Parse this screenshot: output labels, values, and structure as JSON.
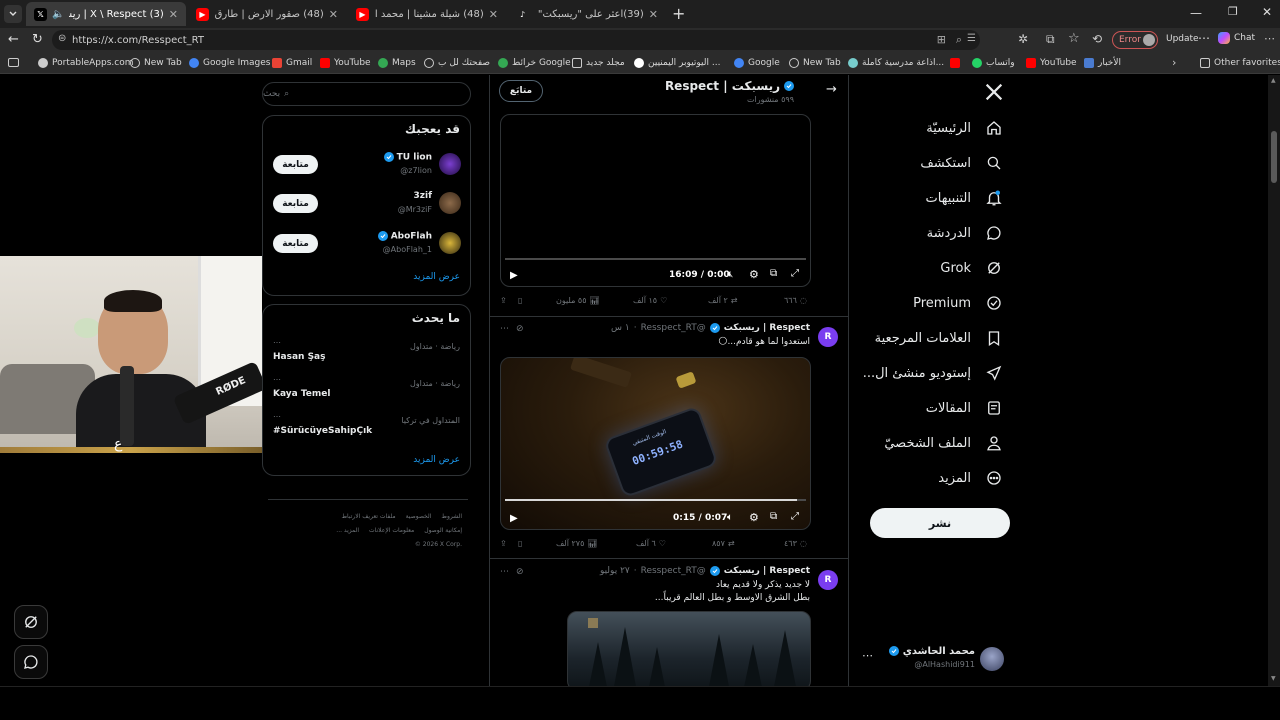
{
  "browser": {
    "tabs": [
      {
        "title": "(3) X \\ Respect | ريسبكت (@Re",
        "favicon": "X",
        "active": true
      },
      {
        "title": "(48) صقور الارض | طارق العربي طر",
        "favicon": "YT",
        "active": false
      },
      {
        "title": "(48) شيلة مشينا | محمد الدخيل | مؤ",
        "favicon": "YT",
        "active": false
      },
      {
        "title": "(39)اعثر على \"ريسبكت\" على TikTok",
        "favicon": "TT",
        "active": false
      }
    ],
    "url": "https://x.com/Resspect_RT",
    "error_label": "Error",
    "update_label": "Update",
    "chat_label": "Chat",
    "bookmarks": [
      "PortableApps.com",
      "New Tab",
      "Google Images",
      "Gmail",
      "YouTube",
      "Maps",
      "صفحتك لل ب",
      "خرائط Google",
      "مجلد جديد",
      "اليوتيوبر اليمنيين ...",
      "Google",
      "New Tab",
      "اذاعة مدرسية كاملة...",
      "واتساب",
      "YouTube",
      "الأخبار"
    ],
    "other_favorites": "Other favorites"
  },
  "x": {
    "nav": [
      {
        "label": "الرئيسيّة",
        "icon": "home-icon"
      },
      {
        "label": "استكشف",
        "icon": "search-icon"
      },
      {
        "label": "التنبيهات",
        "icon": "bell-icon"
      },
      {
        "label": "الدردشة",
        "icon": "chat-icon"
      },
      {
        "label": "Grok",
        "icon": "grok-icon"
      },
      {
        "label": "Premium",
        "icon": "premium-icon"
      },
      {
        "label": "العلامات المرجعية",
        "icon": "bookmark-icon"
      },
      {
        "label": "إستوديو منشئ ال...",
        "icon": "rocket-icon"
      },
      {
        "label": "المقالات",
        "icon": "articles-icon"
      },
      {
        "label": "الملف الشخصيّ",
        "icon": "profile-icon"
      },
      {
        "label": "المزيد",
        "icon": "more-icon"
      }
    ],
    "post_button": "نشر",
    "account": {
      "name": "محمد الحاشدي",
      "handle": "@AlHashidi911"
    },
    "profile": {
      "name": "Respect | ريسبكت",
      "posts": "٥٩٩ منشورات",
      "follow_label": "متابَع"
    },
    "search_placeholder": "بحث",
    "suggest": {
      "title": "قد يعجبك",
      "users": [
        {
          "name": "TU lion",
          "handle": "@z7lion",
          "verified": true,
          "button": "متابعة"
        },
        {
          "name": "3zif",
          "handle": "@Mr3ziF",
          "verified": false,
          "button": "متابعة"
        },
        {
          "name": "AboFlah",
          "handle": "@AboFlah_1",
          "verified": true,
          "button": "متابعة"
        }
      ],
      "more": "عرض المزيد"
    },
    "trends": {
      "title": "ما يحدث",
      "items": [
        {
          "context": "رياضة · متداول",
          "name": "Hasan Şaş"
        },
        {
          "context": "رياضة · متداول",
          "name": "Kaya Temel"
        },
        {
          "context": "المتداول في تركيا",
          "name": "#SürücüyeSahipÇık"
        }
      ],
      "more": "عرض المزيد"
    },
    "footer": {
      "row1": [
        "الشروط",
        "الخصوصية",
        "ملفات تعريف الارتباط"
      ],
      "row2": [
        "إمكانية الوصول",
        "معلومات الإعلانات",
        "المزيد ..."
      ],
      "copyright": "© 2026 X Corp."
    },
    "posts": [
      {
        "time": "16:09 / 0:00",
        "progress": 0,
        "stats": {
          "replies": "٦٦٦",
          "reposts": "٢ آلف",
          "likes": "١٥ آلف",
          "views": "٥٥ مليون"
        }
      },
      {
        "name": "Respect | ريسبكت",
        "handle": "@Resspect_RT",
        "age": "١ س",
        "text": "استعدوا لما هو قادم...🌕",
        "time": "0:15 / 0:07",
        "progress": 0.97,
        "phone_time": "00:59:58",
        "phone_label": "الوقت المتبقي",
        "stats": {
          "replies": "٤٦٣",
          "reposts": "٨٥٧",
          "likes": "٦ آلف",
          "views": "٢٧٥ آلف"
        }
      },
      {
        "name": "Respect | ريسبكت",
        "handle": "@Resspect_RT",
        "age": "٢٧ يوليو",
        "text1": "لا جديد يذكر ولا قديم يعاد",
        "text2": "بطل الشرق الاوسط و بطل العالم قريباً..."
      }
    ]
  },
  "webcam": {
    "mic_label": "RØDE"
  },
  "colors": {
    "accent": "#1d9bf0",
    "bg": "#000000",
    "tab_active": "#3a3a3a"
  }
}
